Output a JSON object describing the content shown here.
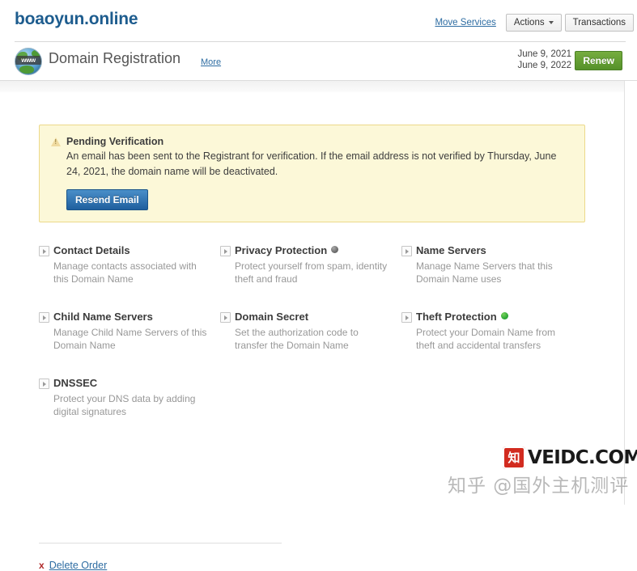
{
  "header": {
    "domain": "boaoyun.online",
    "move_services_label": "Move Services",
    "actions_label": "Actions",
    "transactions_label": "Transactions"
  },
  "product": {
    "icon_name": "globe-www-icon",
    "icon_text": "www",
    "title": "Domain Registration",
    "more_label": "More",
    "registration_date": "June 9, 2021",
    "expiry_date": "June 9, 2022",
    "renew_label": "Renew"
  },
  "alert": {
    "icon_name": "warning-triangle-icon",
    "title": "Pending Verification",
    "message": "An email has been sent to the Registrant for verification. If the email address is not verified by Thursday, June 24, 2021, the domain name will be deactivated.",
    "button_label": "Resend Email",
    "background_color": "#fcf8d8",
    "border_color": "#ecd98a"
  },
  "features": [
    {
      "title": "Contact Details",
      "desc": "Manage contacts associated with this Domain Name",
      "status": null
    },
    {
      "title": "Privacy Protection",
      "desc": "Protect yourself from spam, identity theft and fraud",
      "status": "off"
    },
    {
      "title": "Name Servers",
      "desc": "Manage Name Servers that this Domain Name uses",
      "status": null
    },
    {
      "title": "Child Name Servers",
      "desc": "Manage Child Name Servers of this Domain Name",
      "status": null
    },
    {
      "title": "Domain Secret",
      "desc": "Set the authorization code to transfer the Domain Name",
      "status": null
    },
    {
      "title": "Theft Protection",
      "desc": "Protect your Domain Name from theft and accidental transfers",
      "status": "on"
    },
    {
      "title": "DNSSEC",
      "desc": "Protect your DNS data by adding digital signatures",
      "status": null
    }
  ],
  "footer": {
    "delete_icon": "x",
    "delete_label": "Delete Order"
  },
  "watermarks": {
    "veidc_seal": "知",
    "veidc_text": "VEIDC.COM",
    "zhihu_text": "知乎 @国外主机测评"
  },
  "colors": {
    "link": "#2d6ca2",
    "title": "#1d5c8e",
    "renew_green": "#55912a",
    "status_on": "#2faa37",
    "status_off": "#6e6e6e",
    "delete_red": "#b02a2a"
  }
}
